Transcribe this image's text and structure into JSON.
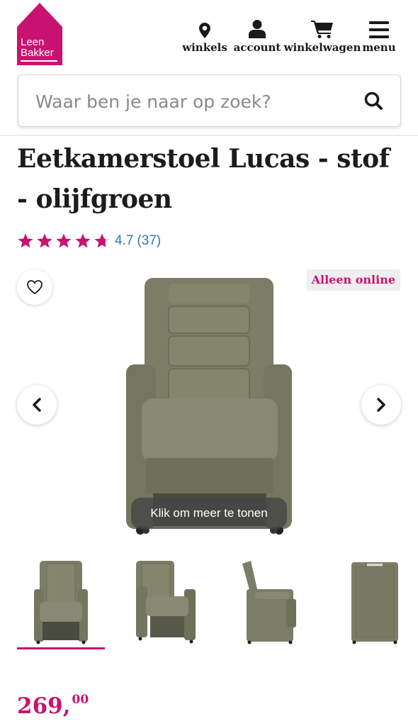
{
  "brand": {
    "name_line1": "Leen",
    "name_line2": "Bakker",
    "color": "#c8126f"
  },
  "nav": {
    "items": [
      {
        "label": "winkels",
        "icon": "location-pin-icon"
      },
      {
        "label": "account",
        "icon": "user-icon"
      },
      {
        "label": "winkelwagen",
        "icon": "cart-icon"
      },
      {
        "label": "menu",
        "icon": "hamburger-icon"
      }
    ]
  },
  "search": {
    "placeholder": "Waar ben je naar op zoek?",
    "value": ""
  },
  "product": {
    "title": "Eetkamerstoel Lucas - stof - olijfgroen",
    "rating": {
      "score": "4.7",
      "count": "(37)",
      "stars": 4.7,
      "max_stars": 5
    },
    "badge": "Alleen online",
    "show_more": "Klik om meer te tonen",
    "price_main": "269,",
    "price_cents": "00",
    "thumbnails": [
      "front",
      "angle",
      "side",
      "back"
    ],
    "active_thumbnail": 0
  },
  "colors": {
    "accent": "#c8126f",
    "link": "#2f78b8",
    "chair": "#7d7f68"
  }
}
